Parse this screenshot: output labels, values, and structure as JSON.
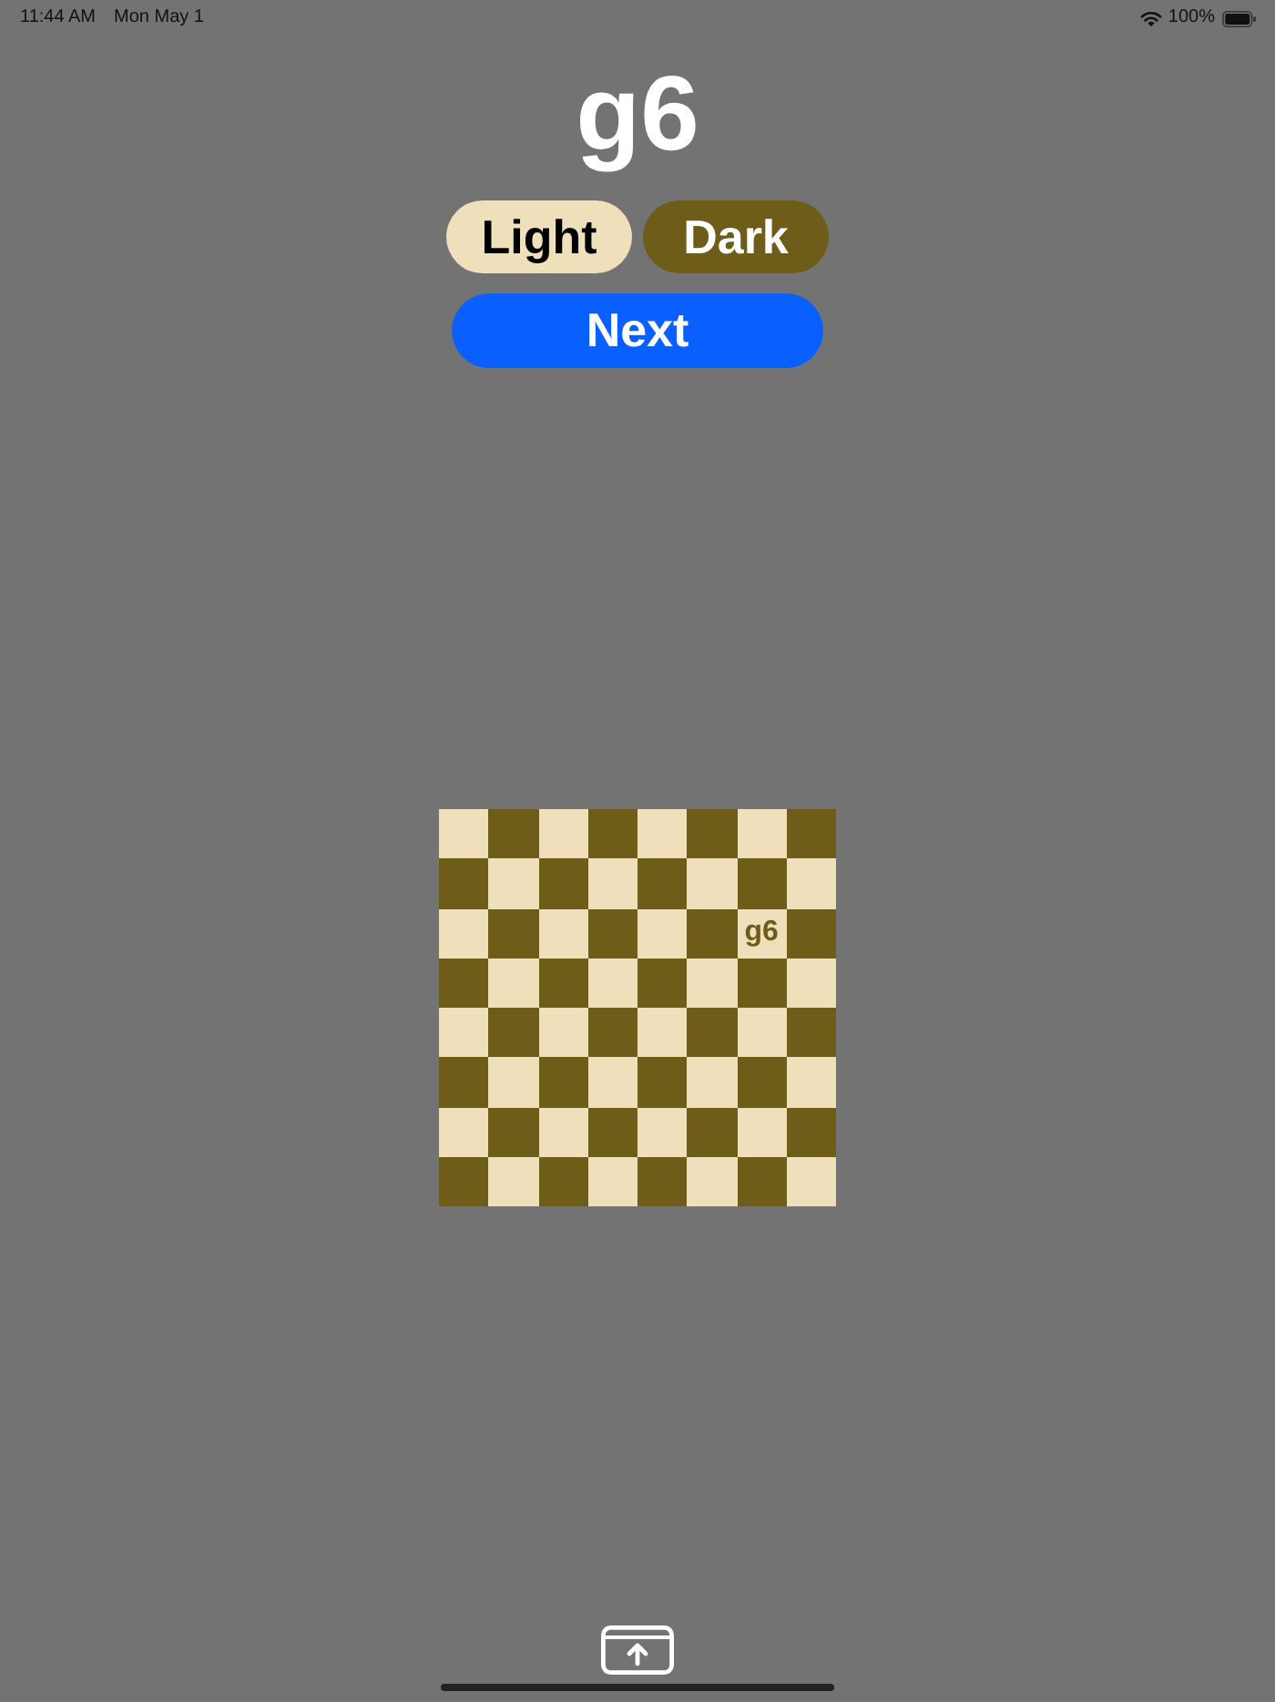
{
  "status_bar": {
    "time": "11:44 AM",
    "date": "Mon May 1",
    "battery": "100%"
  },
  "prompt": {
    "square": "g6"
  },
  "answer_buttons": [
    {
      "label": "Light",
      "kind": "light"
    },
    {
      "label": "Dark",
      "kind": "dark"
    }
  ],
  "next_button": {
    "label": "Next"
  },
  "board": {
    "rows": [
      [
        {
          "kind": "light"
        },
        {
          "kind": "dark"
        },
        {
          "kind": "light"
        },
        {
          "kind": "dark"
        },
        {
          "kind": "light"
        },
        {
          "kind": "dark"
        },
        {
          "kind": "light"
        },
        {
          "kind": "dark"
        }
      ],
      [
        {
          "kind": "dark"
        },
        {
          "kind": "light"
        },
        {
          "kind": "dark"
        },
        {
          "kind": "light"
        },
        {
          "kind": "dark"
        },
        {
          "kind": "light"
        },
        {
          "kind": "dark"
        },
        {
          "kind": "light"
        }
      ],
      [
        {
          "kind": "light"
        },
        {
          "kind": "dark"
        },
        {
          "kind": "light"
        },
        {
          "kind": "dark"
        },
        {
          "kind": "light"
        },
        {
          "kind": "dark"
        },
        {
          "kind": "light",
          "label": "g6"
        },
        {
          "kind": "dark"
        }
      ],
      [
        {
          "kind": "dark"
        },
        {
          "kind": "light"
        },
        {
          "kind": "dark"
        },
        {
          "kind": "light"
        },
        {
          "kind": "dark"
        },
        {
          "kind": "light"
        },
        {
          "kind": "dark"
        },
        {
          "kind": "light"
        }
      ],
      [
        {
          "kind": "light"
        },
        {
          "kind": "dark"
        },
        {
          "kind": "light"
        },
        {
          "kind": "dark"
        },
        {
          "kind": "light"
        },
        {
          "kind": "dark"
        },
        {
          "kind": "light"
        },
        {
          "kind": "dark"
        }
      ],
      [
        {
          "kind": "dark"
        },
        {
          "kind": "light"
        },
        {
          "kind": "dark"
        },
        {
          "kind": "light"
        },
        {
          "kind": "dark"
        },
        {
          "kind": "light"
        },
        {
          "kind": "dark"
        },
        {
          "kind": "light"
        }
      ],
      [
        {
          "kind": "light"
        },
        {
          "kind": "dark"
        },
        {
          "kind": "light"
        },
        {
          "kind": "dark"
        },
        {
          "kind": "light"
        },
        {
          "kind": "dark"
        },
        {
          "kind": "light"
        },
        {
          "kind": "dark"
        }
      ],
      [
        {
          "kind": "dark"
        },
        {
          "kind": "light"
        },
        {
          "kind": "dark"
        },
        {
          "kind": "light"
        },
        {
          "kind": "dark"
        },
        {
          "kind": "light"
        },
        {
          "kind": "dark"
        },
        {
          "kind": "light"
        }
      ]
    ]
  }
}
